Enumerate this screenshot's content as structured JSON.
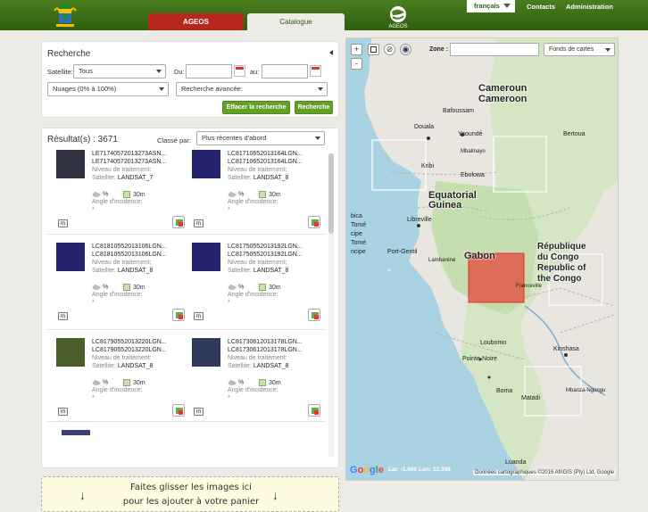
{
  "header": {
    "tabs": [
      {
        "label": "AGEOS"
      },
      {
        "label": "Catalogue"
      }
    ],
    "logo_text": "AGEOS",
    "language": "français",
    "links": [
      "Contacts",
      "Administration"
    ]
  },
  "search": {
    "title": "Recherche",
    "satellite_label": "Satellite:",
    "satellite_value": "Tous",
    "du_label": "Du:",
    "au_label": "au:",
    "clouds_value": "Nuages (0% à 100%)",
    "advanced_value": "Recherche avancée:",
    "clear_button": "Effacer la recherche",
    "search_button": "Recherche"
  },
  "results": {
    "title": "Résultat(s) : 3671",
    "sort_label": "Classé par:",
    "sort_value": "Plus récentes d'abord",
    "level_label": "Niveau de traitement:",
    "satellite_label": "Satellite:",
    "angle_label": "Angle d'incidence:",
    "pct": "%",
    "res": "30m",
    "dot": "*",
    "m": "m",
    "items": [
      {
        "name1": "LE71740572013273ASN...",
        "name2": "LE71740572013273ASN...",
        "satellite": "LANDSAT_7",
        "tone": "dark"
      },
      {
        "name1": "LC81710652013164LGN...",
        "name2": "LC81710652013164LGN...",
        "satellite": "LANDSAT_8",
        "tone": "navy"
      },
      {
        "name1": "LC81810552013106LGN...",
        "name2": "LC81810552013106LGN...",
        "satellite": "LANDSAT_8",
        "tone": "navy"
      },
      {
        "name1": "LC81750552013192LGN...",
        "name2": "LC81750552013192LGN...",
        "satellite": "LANDSAT_8",
        "tone": "navy"
      },
      {
        "name1": "LC81790552013220LGN...",
        "name2": "LC81790552013220LGN...",
        "satellite": "LANDSAT_8",
        "tone": "green"
      },
      {
        "name1": "LC81730612013178LGN...",
        "name2": "LC81730612013178LGN...",
        "satellite": "LANDSAT_8",
        "tone": "navyg"
      }
    ]
  },
  "dropzone": {
    "line1": "Faites glisser les images ici",
    "line2": "pour les ajouter à votre panier",
    "arrow": "↓"
  },
  "map": {
    "zone_label": "Zone :",
    "basemap": "Fonds de cartes",
    "plus": "+",
    "minus": "-",
    "google": "Google",
    "coords": "Lat: -1.000 Lon: 12.398",
    "credit": "Données cartographiques ©2016 AfriGIS (Pty) Ltd, Google",
    "countries": {
      "cameroun": "Cameroun",
      "cameroon": "Cameroon",
      "eq1": "Equatorial",
      "eq2": "Guinea",
      "gabon": "Gabon",
      "rc1": "République",
      "rc2": "du Congo",
      "rc3": "Republic of",
      "rc4": "the Congo"
    },
    "places": {
      "bafoussam": "Bafoussam",
      "bertoua": "Bertoua",
      "douala": "Douala",
      "yaounde": "Yaoundé",
      "mbalmayo": "Mbalmayo",
      "kribi": "Kribi",
      "ebolowa": "Ebolowa",
      "libreville": "Libreville",
      "lambarene": "Lambaréné",
      "portgentil": "Port-Gentil",
      "franceville": "Franceville",
      "loubomo": "Loubomo",
      "pointenoire": "Pointe-Noire",
      "kinshasa": "Kinshasa",
      "boma": "Boma",
      "matadi": "Matadi",
      "luanda": "Luanda",
      "mbanza": "Mbanza-Ngungu",
      "bica": "bica",
      "tome": "Tomé",
      "cipe": "cipe",
      "tomeb": "Tomé",
      "ncipe": "ncipe"
    }
  }
}
